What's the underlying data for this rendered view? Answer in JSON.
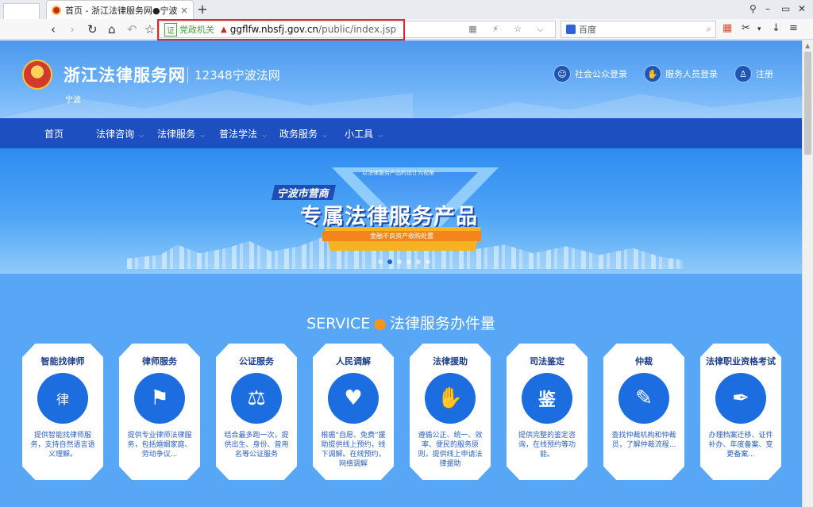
{
  "browser": {
    "tab_title": "首页 - 浙江法律服务网●宁波",
    "tab_close": "×",
    "new_tab": "+",
    "win_min": "–",
    "win_max": "▭",
    "win_close": "✕",
    "back": "‹",
    "forward": "›",
    "reload": "↻",
    "home": "⌂",
    "undo": "↶",
    "star": "☆",
    "address": {
      "badge": "证",
      "label": "党政机关",
      "lock": "▲",
      "domain": "ggflfw.nbsfj.gov.cn",
      "path": "/public/index.jsp",
      "right_icons": "▦ ⚡ ☆ ⌵"
    },
    "search": {
      "placeholder": "百度",
      "icon": "⌕"
    },
    "tools": {
      "t1": "▦",
      "t2": "✂",
      "t3": "▾",
      "t4": "↓",
      "t5": "≡"
    }
  },
  "site": {
    "title": "浙江法律服务网",
    "subtitle": "12348宁波法网",
    "city": "宁波",
    "login": [
      {
        "icon": "☺",
        "label": "社会公众登录"
      },
      {
        "icon": "✋",
        "label": "服务人员登录"
      },
      {
        "icon": "♙",
        "label": "注册"
      }
    ]
  },
  "nav": [
    {
      "label": "首页",
      "dd": ""
    },
    {
      "label": "法律咨询",
      "dd": "⌵"
    },
    {
      "label": "法律服务",
      "dd": "⌵"
    },
    {
      "label": "普法学法",
      "dd": "⌵"
    },
    {
      "label": "政务服务",
      "dd": "⌵"
    },
    {
      "label": "小工具",
      "dd": "⌵"
    }
  ],
  "banner": {
    "top_text": "以法律服务产品的设计为视角",
    "ribbon": "宁波市营商",
    "headline": "专属法律服务产品",
    "sub": "金融不良资产收购处置"
  },
  "services": {
    "title_en": "SERVICE",
    "dot": "●",
    "title_cn": "法律服务办件量",
    "cards": [
      {
        "title": "智能找律师",
        "icon": "律",
        "desc": "提供智能找律师服务，支持自然语言语义理解。"
      },
      {
        "title": "律师服务",
        "icon": "⚑",
        "desc": "提供专业律师法律服务，包括婚姻家庭、劳动争议..."
      },
      {
        "title": "公证服务",
        "icon": "⚖",
        "desc": "结合最多跑一次，提供出生、身份、曾用名等公证服务"
      },
      {
        "title": "人民调解",
        "icon": "♥",
        "desc": "根据“自愿、免费”援助提供线上预约，线下调解。在线预约，网络调解"
      },
      {
        "title": "法律援助",
        "icon": "✋",
        "desc": "遵循公正、统一、效率、便民的服务原则，提供线上申请法律援助"
      },
      {
        "title": "司法鉴定",
        "icon": "鉴",
        "desc": "提供完整的鉴定咨询，在线预约等功能。"
      },
      {
        "title": "仲裁",
        "icon": "✎",
        "desc": "查找仲裁机构和仲裁员，了解仲裁流程..."
      },
      {
        "title": "法律职业资格考试",
        "icon": "✒",
        "desc": "办理档案迁移、证件补办、年度备案、变更备案..."
      }
    ]
  }
}
